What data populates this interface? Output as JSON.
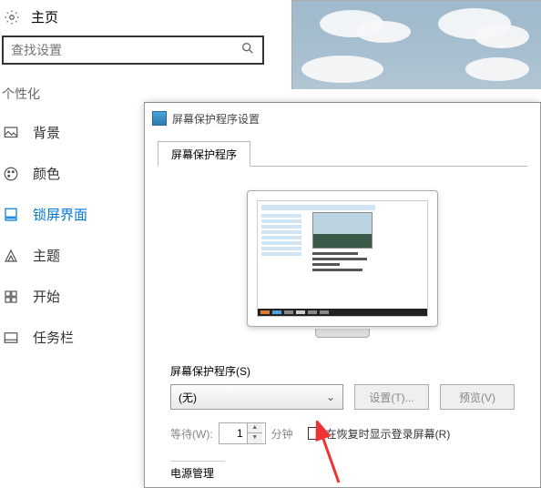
{
  "home_label": "主页",
  "search_placeholder": "查找设置",
  "section": "个性化",
  "nav": [
    {
      "label": "背景"
    },
    {
      "label": "颜色"
    },
    {
      "label": "锁屏界面"
    },
    {
      "label": "主题"
    },
    {
      "label": "开始"
    },
    {
      "label": "任务栏"
    }
  ],
  "dialog": {
    "title": "屏幕保护程序设置",
    "tab": "屏幕保护程序",
    "saver_label": "屏幕保护程序(S)",
    "saver_value": "(无)",
    "settings_btn": "设置(T)...",
    "preview_btn": "预览(V)",
    "wait_label": "等待(W):",
    "wait_value": "1",
    "wait_unit": "分钟",
    "resume_label": "在恢复时显示登录屏幕(R)",
    "power_label": "电源管理"
  }
}
